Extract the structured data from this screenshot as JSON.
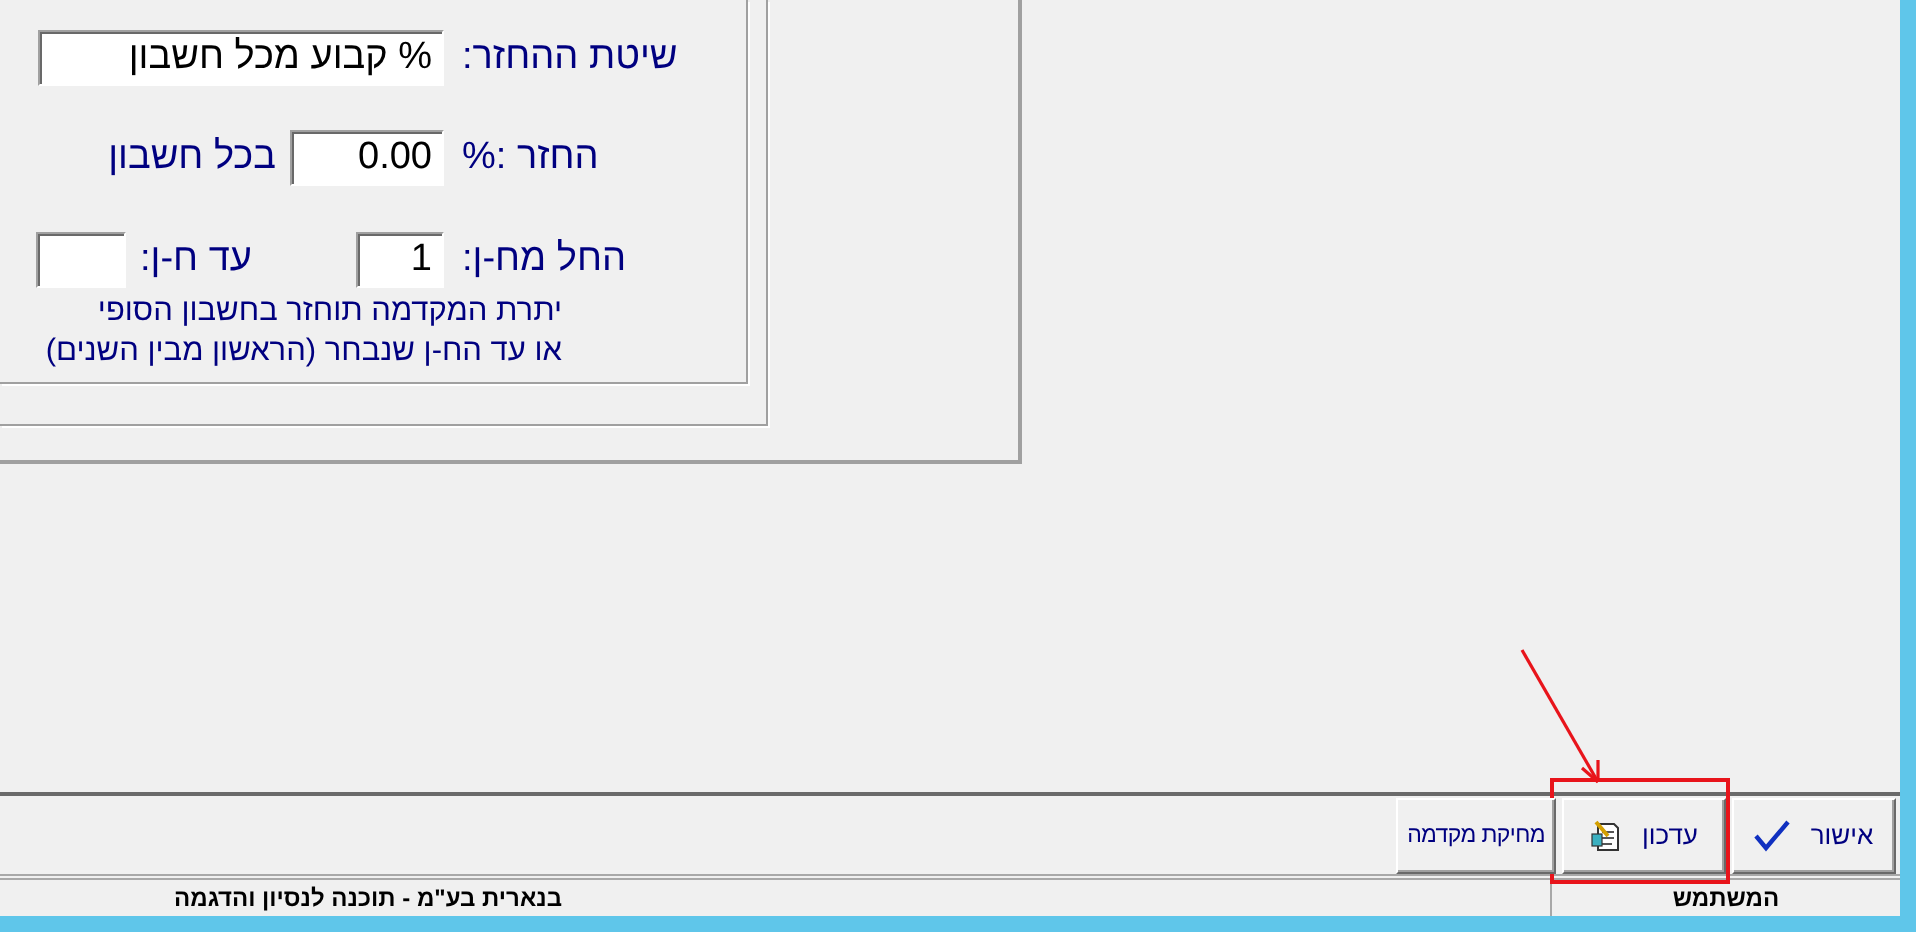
{
  "return_method": {
    "label": "שיטת ההחזר:",
    "value": "% קבוע מכל חשבון"
  },
  "return_percent": {
    "label": "החזר :%",
    "value": "0.00",
    "suffix": "בכל חשבון"
  },
  "account_range": {
    "from_label": "החל מח-ן:",
    "from_value": "1",
    "to_label": "עד ח-ן:"
  },
  "note": [
    "יתרת המקדמה תוחזר בחשבון הסופי",
    "או עד הח-ן שנבחר (הראשון מבין השנים)"
  ],
  "toolbar": {
    "buttons": [
      {
        "kind": "confirm",
        "label": "אישור",
        "highlighted": false
      },
      {
        "kind": "update",
        "label": "עדכון",
        "highlighted": true
      },
      {
        "kind": "plain",
        "label": "מחיקת מקדמה",
        "highlighted": false
      }
    ]
  },
  "status_bar": {
    "user_label": "המשתמש",
    "company": "בנארית בע\"מ - תוכנה לנסיון והדגמה"
  }
}
